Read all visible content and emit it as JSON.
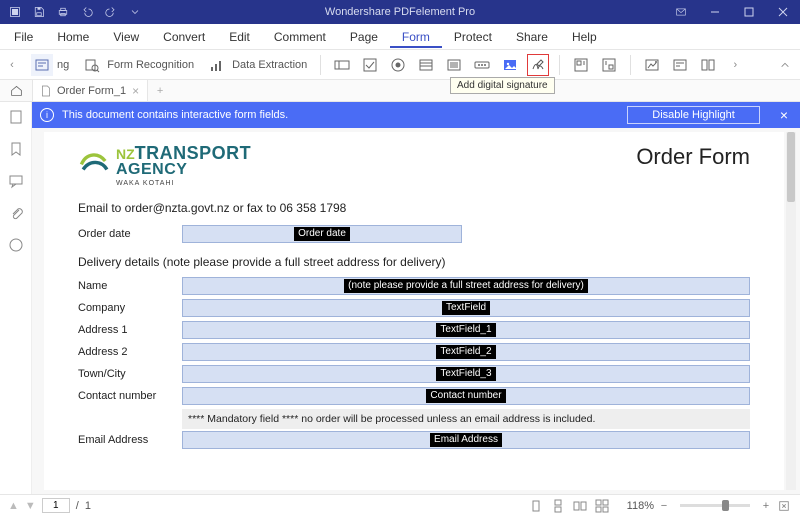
{
  "titlebar": {
    "title": "Wondershare PDFelement Pro"
  },
  "menu": {
    "items": [
      "File",
      "Home",
      "View",
      "Convert",
      "Edit",
      "Comment",
      "Page",
      "Form",
      "Protect",
      "Share",
      "Help"
    ],
    "active": "Form"
  },
  "ribbon": {
    "form_recognition": "Form Recognition",
    "data_extraction": "Data Extraction",
    "tooltip": "Add digital signature"
  },
  "tabs": {
    "doc_name": "Order Form_1"
  },
  "banner": {
    "message": "This document contains interactive form fields.",
    "disable": "Disable Highlight"
  },
  "document": {
    "logo": {
      "line1": "TRANSPORT",
      "line2": "AGENCY",
      "sub": "WAKA KOTAHI",
      "nz": "NZ"
    },
    "title": "Order Form",
    "email_line": "Email to order@nzta.govt.nz or fax to 06 358 1798",
    "order_date_label": "Order date",
    "order_date_tag": "Order date",
    "delivery_heading": "Delivery details (note please provide a full street address for delivery)",
    "rows": {
      "name": {
        "label": "Name",
        "tag": "(note please provide a full street address for delivery)"
      },
      "company": {
        "label": "Company",
        "tag": "TextField"
      },
      "addr1": {
        "label": "Address 1",
        "tag": "TextField_1"
      },
      "addr2": {
        "label": "Address 2",
        "tag": "TextField_2"
      },
      "town": {
        "label": "Town/City",
        "tag": "TextField_3"
      },
      "contact": {
        "label": "Contact number",
        "tag": "Contact number"
      },
      "email": {
        "label": "Email Address",
        "tag": "Email Address"
      }
    },
    "mandatory_note": "**** Mandatory field **** no order will be processed unless an email address is included."
  },
  "status": {
    "page_current": "1",
    "page_sep": "/",
    "page_total": "1",
    "zoom": "118%"
  }
}
